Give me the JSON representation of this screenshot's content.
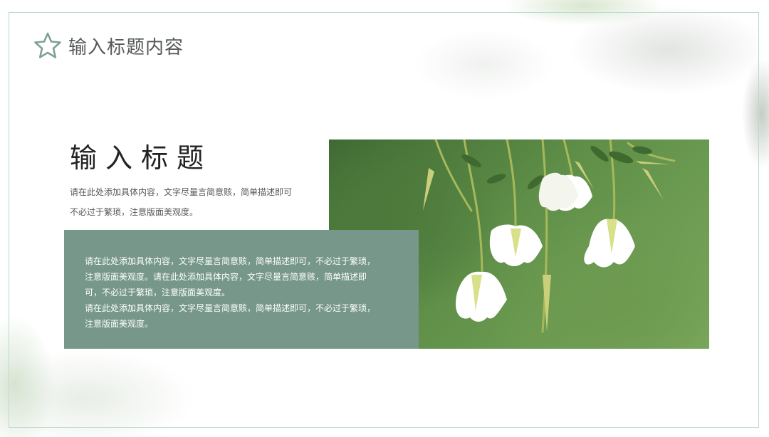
{
  "header": {
    "title": "输入标题内容",
    "icon": "star-outline-icon"
  },
  "section": {
    "title": "输入标题",
    "intro_lines": [
      "请在此处添加具体内容，文字尽量言简意赅，简单描述即可",
      "不必过于繁琐，注意版面美观度。"
    ]
  },
  "text_box": {
    "paragraph_1_lines": [
      "请在此处添加具体内容，文字尽量言简意赅，简单描述即可，不必过于繁琐，",
      "注意版面美观度。请在此处添加具体内容，文字尽量言简意赅，简单描述即",
      "可，不必过于繁琐，注意版面美观度。"
    ],
    "paragraph_2_lines": [
      "请在此处添加具体内容，文字尽量言简意赅，简单描述即可，不必过于繁琐，",
      "注意版面美观度。"
    ]
  },
  "colors": {
    "accent_panel": "#76978a",
    "frame_border": "#b9d9cf",
    "star_outline": "#7fa196",
    "title_text": "#222222"
  }
}
